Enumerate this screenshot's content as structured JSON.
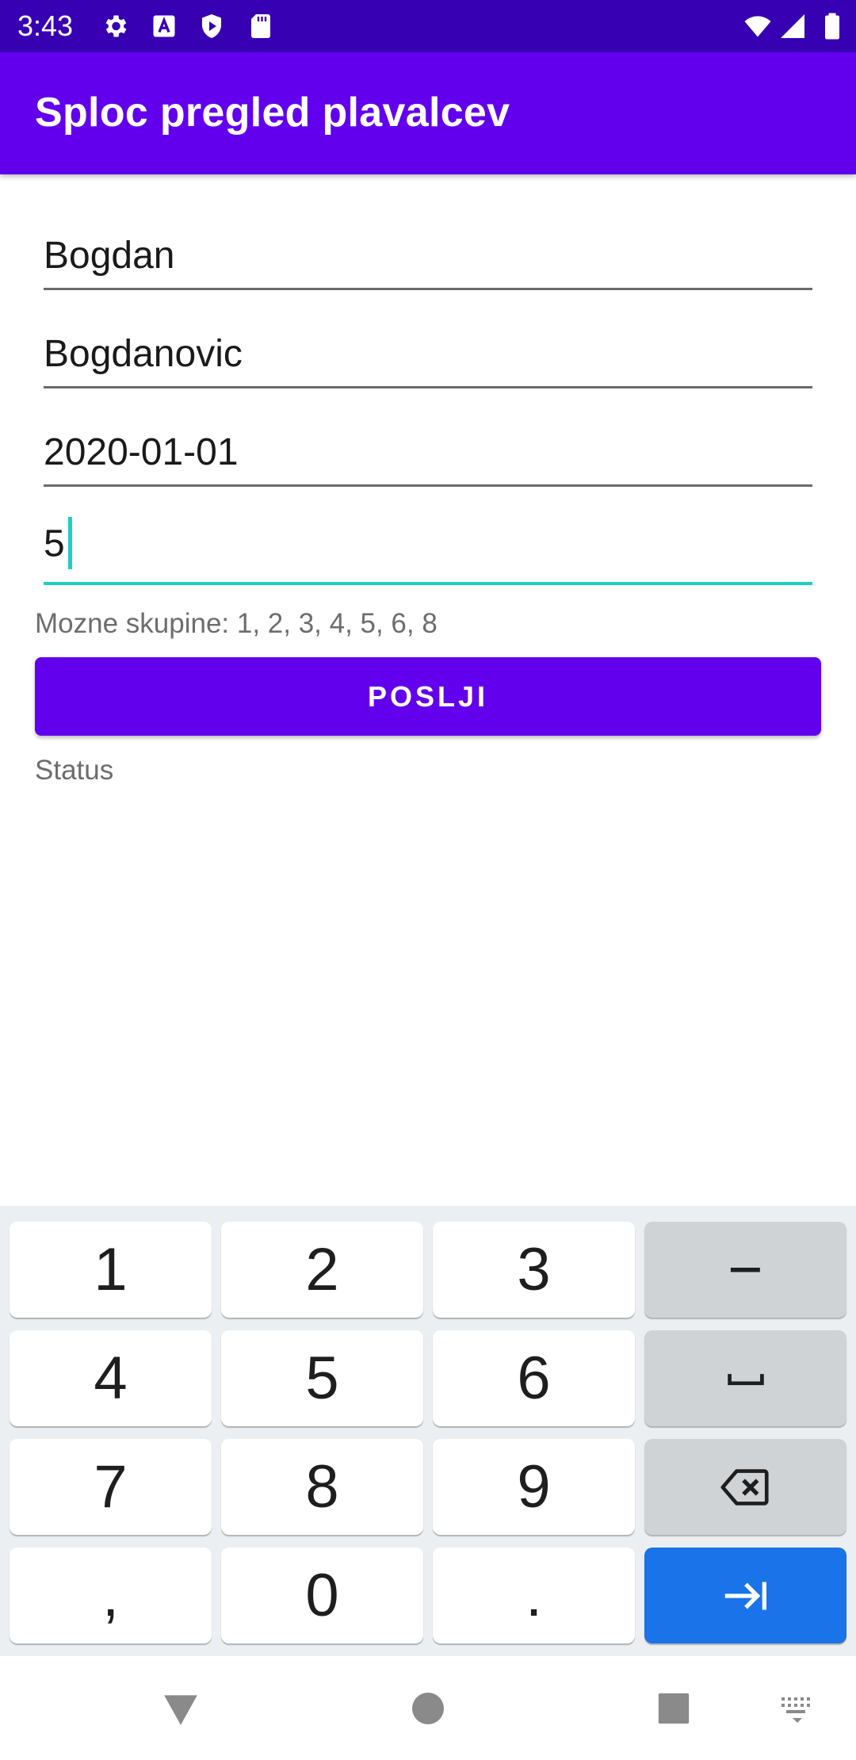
{
  "status_bar": {
    "time": "3:43",
    "left_icons": [
      "gear-icon",
      "a-badge-icon",
      "shield-play-icon",
      "sd-card-icon"
    ],
    "right_icons": [
      "wifi-icon",
      "signal-icon",
      "battery-icon"
    ]
  },
  "app_bar": {
    "title": "Sploc pregled plavalcev"
  },
  "form": {
    "first_name": "Bogdan",
    "last_name": "Bogdanovic",
    "date": "2020-01-01",
    "group": "5",
    "hint": "Mozne skupine: 1, 2, 3, 4, 5, 6, 8",
    "send_label": "POSLJI",
    "status": "Status"
  },
  "keyboard": {
    "rows": [
      [
        "1",
        "2",
        "3",
        "−"
      ],
      [
        "4",
        "5",
        "6",
        "space"
      ],
      [
        "7",
        "8",
        "9",
        "backspace"
      ],
      [
        ",",
        "0",
        ".",
        "next"
      ]
    ],
    "keys": {
      "k1": "1",
      "k2": "2",
      "k3": "3",
      "minus": "−",
      "k4": "4",
      "k5": "5",
      "k6": "6",
      "k7": "7",
      "k8": "8",
      "k9": "9",
      "comma": ",",
      "k0": "0",
      "period": "."
    },
    "action_color": "#1a73e8"
  },
  "nav_bar": {
    "icons": [
      "back-icon",
      "home-icon",
      "recents-icon",
      "keyboard-switch-icon"
    ]
  },
  "colors": {
    "primary": "#6200ee",
    "primary_dark": "#3700b3",
    "accent": "#1bd0c3"
  }
}
